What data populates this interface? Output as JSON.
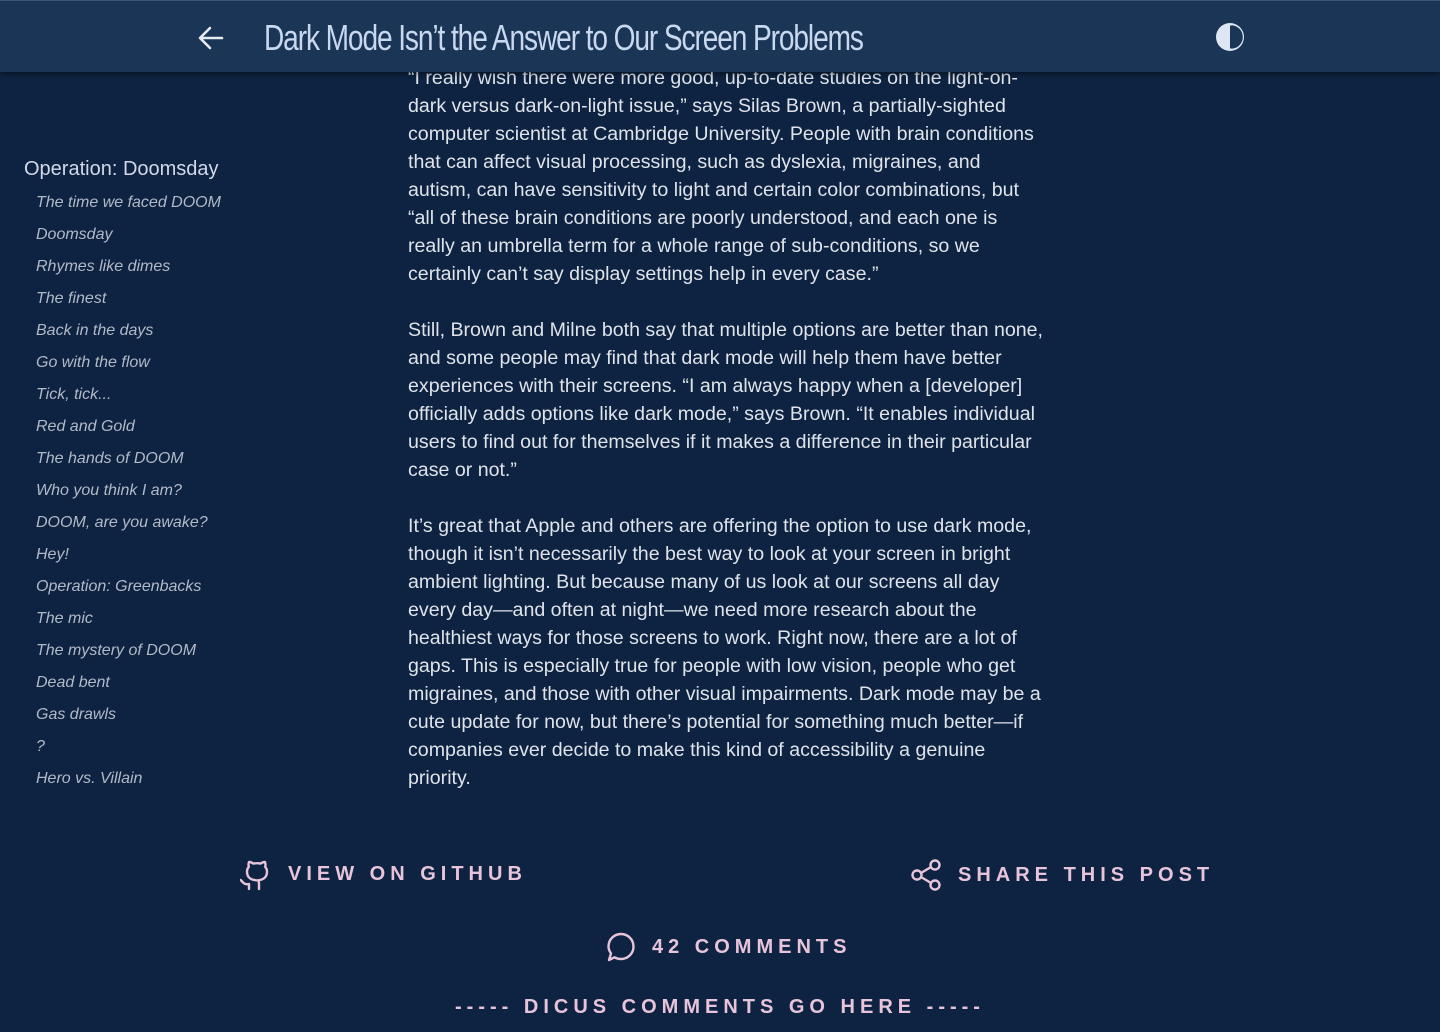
{
  "header": {
    "title": "Dark Mode Isn’t the Answer to Our Screen Problems",
    "back_icon": "arrow-left-icon",
    "theme_icon": "half-moon-contrast-icon"
  },
  "toc": {
    "heading": "Operation: Doomsday",
    "items": [
      "The time we faced DOOM",
      "Doomsday",
      "Rhymes like dimes",
      "The finest",
      "Back in the days",
      "Go with the flow",
      "Tick, tick...",
      "Red and Gold",
      "The hands of DOOM",
      "Who you think I am?",
      "DOOM, are you awake?",
      "Hey!",
      "Operation: Greenbacks",
      "The mic",
      "The mystery of DOOM",
      "Dead bent",
      "Gas drawls",
      "?",
      "Hero vs. Villain"
    ]
  },
  "article": {
    "paragraphs": [
      "“I really wish there were more good, up-to-date studies on the light-on-dark versus dark-on-light issue,” says Silas Brown, a partially-sighted computer scientist at Cambridge University. People with brain conditions that can affect visual processing, such as dyslexia, migraines, and autism, can have sensitivity to light and certain color combinations, but “all of these brain conditions are poorly understood, and each one is really an umbrella term for a whole range of sub-conditions, so we certainly can’t say display settings help in every case.”",
      "Still, Brown and Milne both say that multiple options are better than none, and some people may find that dark mode will help them have better experiences with their screens. “I am always happy when a [developer] officially adds options like dark mode,” says Brown. “It enables individual users to find out for themselves if it makes a difference in their particular case or not.”",
      "It’s great that Apple and others are offering the option to use dark mode, though it isn’t necessarily the best way to look at your screen in bright ambient lighting. But because many of us look at our screens all day every day—and often at night—we need more research about the healthiest ways for those screens to work. Right now, there are a lot of gaps. This is especially true for people with low vision, people who get migraines, and those with other visual impairments. Dark mode may be a cute update for now, but there’s potential for something much better—if companies ever decide to make this kind of accessibility a genuine priority."
    ]
  },
  "footer": {
    "github_label": "VIEW ON GITHUB",
    "github_icon": "github-icon",
    "share_label": "SHARE THIS POST",
    "share_icon": "share-icon",
    "comments_label": "42 COMMENTS",
    "comments_icon": "speech-bubble-icon",
    "disqus_placeholder": "----- DICUS COMMENTS GO HERE -----"
  },
  "colors": {
    "background": "#0d2341",
    "header": "#1a3556",
    "accent": "#e8c4da",
    "title": "#c8d8ee"
  }
}
